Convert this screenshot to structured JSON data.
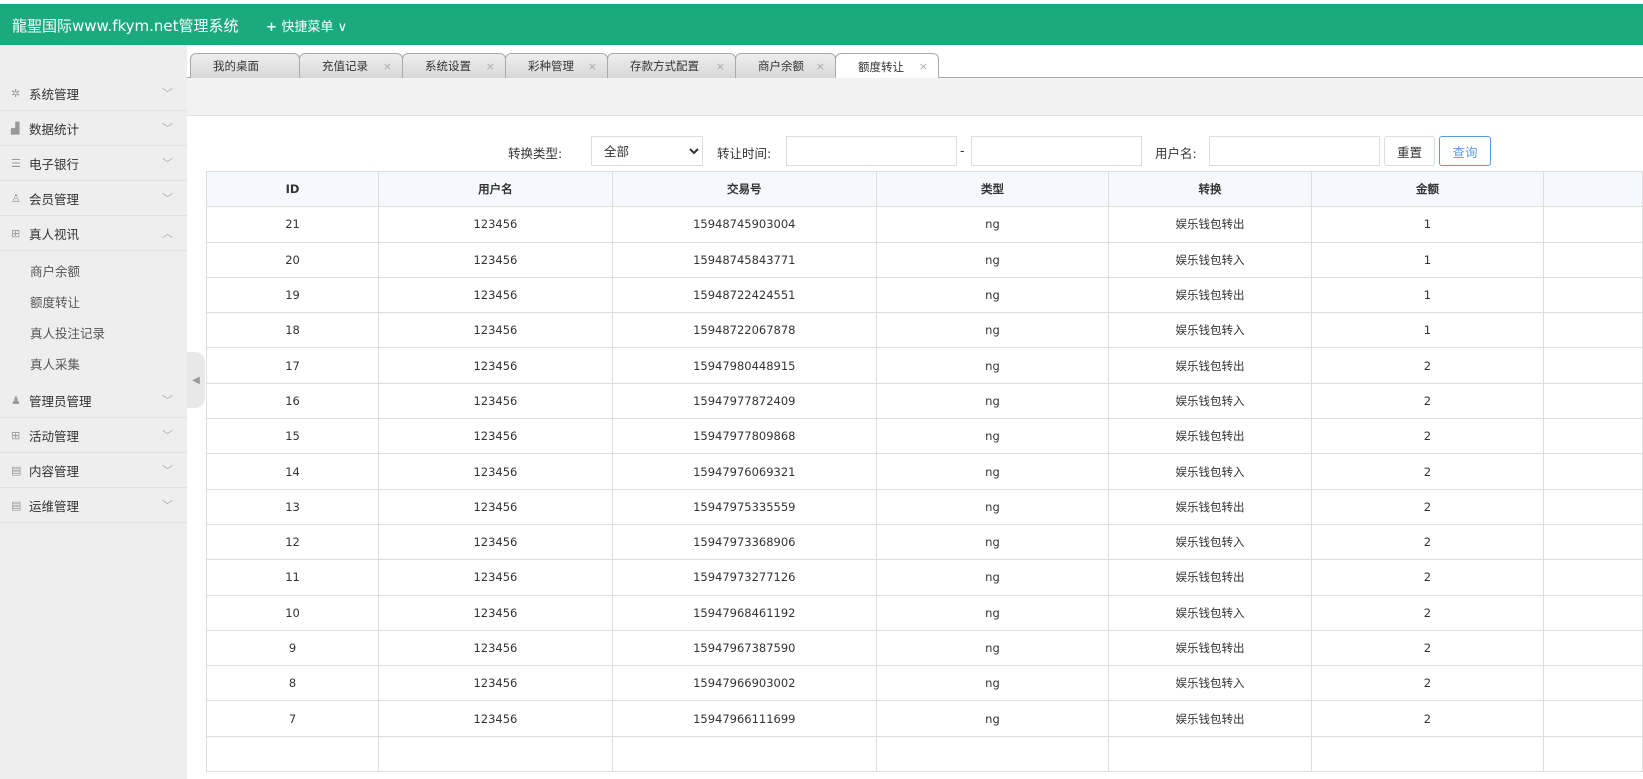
{
  "header": {
    "title": "龍聖国际www.fkym.net管理系统",
    "quick_menu": "快捷菜单"
  },
  "sidebar": {
    "items": [
      {
        "label": "系统管理",
        "icon": "gear-icon",
        "glyph": "✲",
        "expanded": false
      },
      {
        "label": "数据统计",
        "icon": "chart-icon",
        "glyph": "▟",
        "expanded": false
      },
      {
        "label": "电子银行",
        "icon": "list-icon",
        "glyph": "☰",
        "expanded": false
      },
      {
        "label": "会员管理",
        "icon": "user-icon",
        "glyph": "♙",
        "expanded": false
      },
      {
        "label": "真人视讯",
        "icon": "gift-icon",
        "glyph": "⊞",
        "expanded": true
      },
      {
        "label": "管理员管理",
        "icon": "admin-icon",
        "glyph": "♟",
        "expanded": false
      },
      {
        "label": "活动管理",
        "icon": "gift-icon",
        "glyph": "⊞",
        "expanded": false
      },
      {
        "label": "内容管理",
        "icon": "document-icon",
        "glyph": "▤",
        "expanded": false
      },
      {
        "label": "运维管理",
        "icon": "document-icon",
        "glyph": "▤",
        "expanded": false
      }
    ],
    "sub_items": [
      "商户余额",
      "额度转让",
      "真人投注记录",
      "真人采集"
    ]
  },
  "tabs": [
    {
      "label": "我的桌面",
      "closable": false
    },
    {
      "label": "充值记录",
      "closable": true
    },
    {
      "label": "系统设置",
      "closable": true
    },
    {
      "label": "彩种管理",
      "closable": true
    },
    {
      "label": "存款方式配置",
      "closable": true
    },
    {
      "label": "商户余额",
      "closable": true
    },
    {
      "label": "额度转让",
      "closable": true,
      "active": true
    }
  ],
  "filters": {
    "type_label": "转换类型:",
    "type_value": "全部",
    "time_label": "转让时间:",
    "time_sep": "-",
    "user_label": "用户名:",
    "reset": "重置",
    "query": "查询"
  },
  "table": {
    "columns": [
      "ID",
      "用户名",
      "交易号",
      "类型",
      "转换",
      "金额"
    ],
    "rows": [
      [
        "21",
        "123456",
        "15948745903004",
        "ng",
        "娱乐钱包转出",
        "1"
      ],
      [
        "20",
        "123456",
        "15948745843771",
        "ng",
        "娱乐钱包转入",
        "1"
      ],
      [
        "19",
        "123456",
        "15948722424551",
        "ng",
        "娱乐钱包转出",
        "1"
      ],
      [
        "18",
        "123456",
        "15948722067878",
        "ng",
        "娱乐钱包转入",
        "1"
      ],
      [
        "17",
        "123456",
        "15947980448915",
        "ng",
        "娱乐钱包转出",
        "2"
      ],
      [
        "16",
        "123456",
        "15947977872409",
        "ng",
        "娱乐钱包转入",
        "2"
      ],
      [
        "15",
        "123456",
        "15947977809868",
        "ng",
        "娱乐钱包转出",
        "2"
      ],
      [
        "14",
        "123456",
        "15947976069321",
        "ng",
        "娱乐钱包转入",
        "2"
      ],
      [
        "13",
        "123456",
        "15947975335559",
        "ng",
        "娱乐钱包转出",
        "2"
      ],
      [
        "12",
        "123456",
        "15947973368906",
        "ng",
        "娱乐钱包转入",
        "2"
      ],
      [
        "11",
        "123456",
        "15947973277126",
        "ng",
        "娱乐钱包转出",
        "2"
      ],
      [
        "10",
        "123456",
        "15947968461192",
        "ng",
        "娱乐钱包转入",
        "2"
      ],
      [
        "9",
        "123456",
        "15947967387590",
        "ng",
        "娱乐钱包转出",
        "2"
      ],
      [
        "8",
        "123456",
        "15947966903002",
        "ng",
        "娱乐钱包转入",
        "2"
      ],
      [
        "7",
        "123456",
        "15947966111699",
        "ng",
        "娱乐钱包转出",
        "2"
      ],
      [
        "",
        "",
        "",
        "",
        "",
        ""
      ]
    ]
  }
}
